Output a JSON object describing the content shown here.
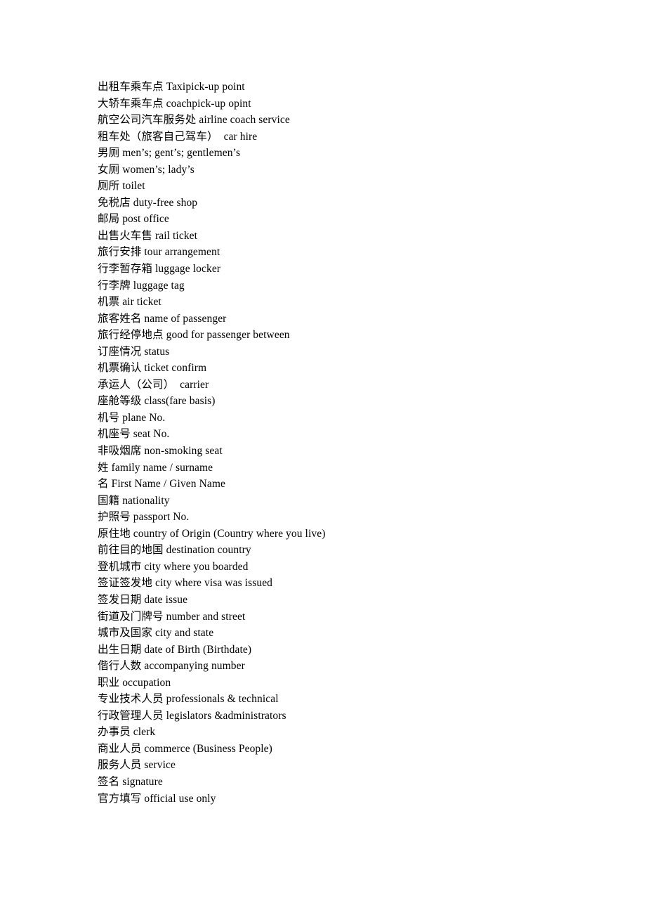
{
  "document": {
    "type": "glossary-list",
    "language_pair": "Chinese-English",
    "page_background": "#ffffff",
    "text_color": "#000000",
    "entries": [
      {
        "cn": "出租车乘车点",
        "en": "Taxipick-up point"
      },
      {
        "cn": "大轿车乘车点",
        "en": "coachpick-up opint"
      },
      {
        "cn": "航空公司汽车服务处",
        "en": "airline coach service"
      },
      {
        "cn": "租车处（旅客自己驾车）",
        "en": " car hire"
      },
      {
        "cn": "男厕",
        "en": "men’s; gent’s; gentlemen’s"
      },
      {
        "cn": "女厕",
        "en": "women’s; lady’s"
      },
      {
        "cn": "厕所",
        "en": "toilet"
      },
      {
        "cn": "免税店",
        "en": "duty-free shop"
      },
      {
        "cn": "邮局",
        "en": "post office"
      },
      {
        "cn": "出售火车售",
        "en": "rail ticket"
      },
      {
        "cn": "旅行安排",
        "en": "tour arrangement"
      },
      {
        "cn": "行李暂存箱",
        "en": "luggage locker"
      },
      {
        "cn": "行李牌",
        "en": "luggage tag"
      },
      {
        "cn": "机票",
        "en": "air ticket"
      },
      {
        "cn": "旅客姓名",
        "en": "name of passenger"
      },
      {
        "cn": "旅行经停地点",
        "en": "good for passenger between"
      },
      {
        "cn": "订座情况",
        "en": "status"
      },
      {
        "cn": "机票确认",
        "en": "ticket confirm"
      },
      {
        "cn": "承运人（公司）",
        "en": " carrier"
      },
      {
        "cn": "座舱等级",
        "en": "class(fare basis)"
      },
      {
        "cn": "机号",
        "en": "plane No."
      },
      {
        "cn": "机座号",
        "en": "seat No."
      },
      {
        "cn": "非吸烟席",
        "en": "non-smoking seat"
      },
      {
        "cn": "姓",
        "en": "family name / surname"
      },
      {
        "cn": "名",
        "en": "First Name / Given Name"
      },
      {
        "cn": "国籍",
        "en": "nationality"
      },
      {
        "cn": "护照号",
        "en": "passport No."
      },
      {
        "cn": "原住地",
        "en": "country of Origin (Country where you live)"
      },
      {
        "cn": "前往目的地国",
        "en": "destination country"
      },
      {
        "cn": "登机城市",
        "en": "city where you boarded"
      },
      {
        "cn": "签证签发地",
        "en": "city where visa was issued"
      },
      {
        "cn": "签发日期",
        "en": "date issue"
      },
      {
        "cn": "街道及门牌号",
        "en": "number and street"
      },
      {
        "cn": "城市及国家",
        "en": "city and state"
      },
      {
        "cn": "出生日期",
        "en": "date of Birth (Birthdate)"
      },
      {
        "cn": "偕行人数",
        "en": "accompanying number"
      },
      {
        "cn": "职业",
        "en": "occupation"
      },
      {
        "cn": "专业技术人员",
        "en": "professionals & technical"
      },
      {
        "cn": "行政管理人员",
        "en": "legislators &administrators"
      },
      {
        "cn": "办事员",
        "en": "clerk"
      },
      {
        "cn": "商业人员",
        "en": "commerce (Business People)"
      },
      {
        "cn": "服务人员",
        "en": "service"
      },
      {
        "cn": "签名",
        "en": "signature"
      },
      {
        "cn": "官方填写",
        "en": "official use only"
      }
    ]
  }
}
